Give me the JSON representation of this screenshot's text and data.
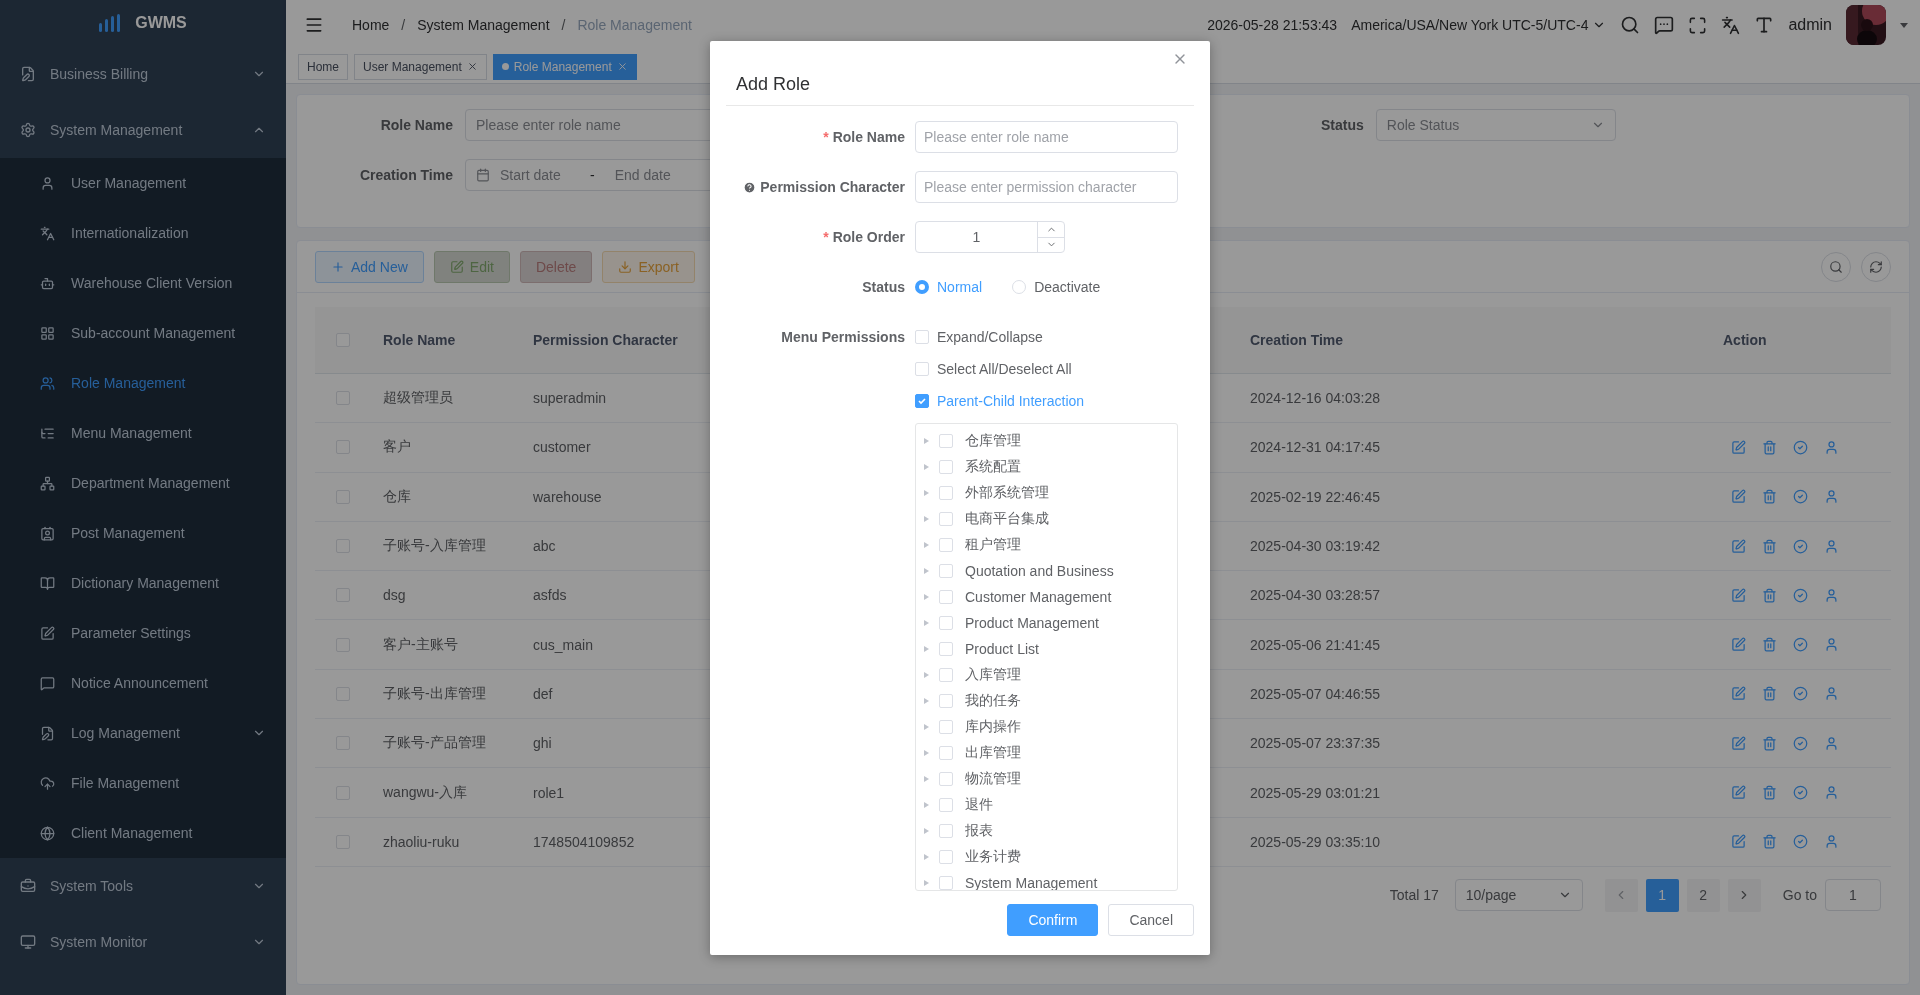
{
  "sidebar": {
    "logo": "GWMS",
    "items": [
      {
        "label": "Business Billing",
        "expanded": false
      },
      {
        "label": "System Management",
        "expanded": true,
        "children": [
          {
            "label": "User Management",
            "selected": false
          },
          {
            "label": "Internationalization",
            "selected": false
          },
          {
            "label": "Warehouse Client Version",
            "selected": false
          },
          {
            "label": "Sub-account Management",
            "selected": false
          },
          {
            "label": "Role Management",
            "selected": true
          },
          {
            "label": "Menu Management",
            "selected": false
          },
          {
            "label": "Department Management",
            "selected": false
          },
          {
            "label": "Post Management",
            "selected": false
          },
          {
            "label": "Dictionary Management",
            "selected": false
          },
          {
            "label": "Parameter Settings",
            "selected": false
          },
          {
            "label": "Notice Announcement",
            "selected": false
          },
          {
            "label": "Log Management",
            "selected": false,
            "expanded": false
          },
          {
            "label": "File Management",
            "selected": false
          },
          {
            "label": "Client Management",
            "selected": false
          }
        ]
      },
      {
        "label": "System Tools",
        "expanded": false
      },
      {
        "label": "System Monitor",
        "expanded": false
      }
    ]
  },
  "header": {
    "breadcrumbs": [
      "Home",
      "System Management",
      "Role Management"
    ],
    "separator": "/",
    "datetime": "2026-05-28 21:53:43",
    "timezone": "America/USA/New York UTC-5/UTC-4",
    "user": "admin"
  },
  "tabs": [
    {
      "label": "Home",
      "selected": false,
      "closable": false
    },
    {
      "label": "User Management",
      "selected": false,
      "closable": true
    },
    {
      "label": "Role Management",
      "selected": true,
      "closable": true
    }
  ],
  "filter": {
    "role_name": {
      "label": "Role Name",
      "placeholder": "Please enter role name"
    },
    "creation_time": {
      "label": "Creation Time",
      "start_placeholder": "Start date",
      "separator": "-",
      "end_placeholder": "End date"
    },
    "status": {
      "label": "Status",
      "placeholder": "Role Status"
    }
  },
  "toolbar": [
    {
      "label": "Add New",
      "kind": "primary",
      "disabled": false
    },
    {
      "label": "Edit",
      "kind": "success",
      "disabled": true
    },
    {
      "label": "Delete",
      "kind": "danger",
      "disabled": true
    },
    {
      "label": "Export",
      "kind": "warning",
      "disabled": false
    }
  ],
  "table": {
    "header_checked": false,
    "columns": [
      "Role Name",
      "Permission Character",
      "Creation Time",
      "Action"
    ],
    "rows": [
      {
        "role_name": "超级管理员",
        "permission_character": "superadmin",
        "creation_time": "2024-12-16 04:03:28",
        "checked": false,
        "actions_visible": false
      },
      {
        "role_name": "客户",
        "permission_character": "customer",
        "creation_time": "2024-12-31 04:17:45",
        "checked": false,
        "actions_visible": true
      },
      {
        "role_name": "仓库",
        "permission_character": "warehouse",
        "creation_time": "2025-02-19 22:46:45",
        "checked": false,
        "actions_visible": true
      },
      {
        "role_name": "子账号-入库管理",
        "permission_character": "abc",
        "creation_time": "2025-04-30 03:19:42",
        "checked": false,
        "actions_visible": true
      },
      {
        "role_name": "dsg",
        "permission_character": "asfds",
        "creation_time": "2025-04-30 03:28:57",
        "checked": false,
        "actions_visible": true
      },
      {
        "role_name": "客户-主账号",
        "permission_character": "cus_main",
        "creation_time": "2025-05-06 21:41:45",
        "checked": false,
        "actions_visible": true
      },
      {
        "role_name": "子账号-出库管理",
        "permission_character": "def",
        "creation_time": "2025-05-07 04:46:55",
        "checked": false,
        "actions_visible": true
      },
      {
        "role_name": "子账号-产品管理",
        "permission_character": "ghi",
        "creation_time": "2025-05-07 23:37:35",
        "checked": false,
        "actions_visible": true
      },
      {
        "role_name": "wangwu-入库",
        "permission_character": "role1",
        "creation_time": "2025-05-29 03:01:21",
        "checked": false,
        "actions_visible": true
      },
      {
        "role_name": "zhaoliu-ruku",
        "permission_character": "1748504109852",
        "creation_time": "2025-05-29 03:35:10",
        "checked": false,
        "actions_visible": true
      }
    ]
  },
  "pagination": {
    "total": "Total 17",
    "page_size": "10/page",
    "pages": [
      {
        "label": "1",
        "selected": true
      },
      {
        "label": "2",
        "selected": false
      }
    ],
    "goto_label": "Go to",
    "goto_value": "1"
  },
  "modal": {
    "title": "Add Role",
    "required_mark": "*",
    "fields": [
      {
        "kind": "text",
        "label": "Role Name",
        "required": true,
        "help": false,
        "placeholder": "Please enter role name"
      },
      {
        "kind": "text",
        "label": "Permission Character",
        "required": false,
        "help": true,
        "placeholder": "Please enter permission character"
      },
      {
        "kind": "number",
        "label": "Role Order",
        "required": true,
        "help": false,
        "value": "1"
      },
      {
        "kind": "radio",
        "label": "Status",
        "required": false,
        "help": false,
        "options": [
          {
            "label": "Normal",
            "selected": true
          },
          {
            "label": "Deactivate",
            "selected": false
          }
        ]
      },
      {
        "kind": "permissions",
        "label": "Menu Permissions",
        "required": false,
        "help": false,
        "options": [
          {
            "label": "Expand/Collapse",
            "checked": false
          },
          {
            "label": "Select All/Deselect All",
            "checked": false
          },
          {
            "label": "Parent-Child Interaction",
            "checked": true
          }
        ],
        "tree": [
          {
            "label": "仓库管理",
            "checked": false,
            "expanded": false
          },
          {
            "label": "系统配置",
            "checked": false,
            "expanded": false
          },
          {
            "label": "外部系统管理",
            "checked": false,
            "expanded": false
          },
          {
            "label": "电商平台集成",
            "checked": false,
            "expanded": false
          },
          {
            "label": "租户管理",
            "checked": false,
            "expanded": false
          },
          {
            "label": "Quotation and Business",
            "checked": false,
            "expanded": false
          },
          {
            "label": "Customer Management",
            "checked": false,
            "expanded": false
          },
          {
            "label": "Product Management",
            "checked": false,
            "expanded": false
          },
          {
            "label": "Product List",
            "checked": false,
            "expanded": false
          },
          {
            "label": "入库管理",
            "checked": false,
            "expanded": false
          },
          {
            "label": "我的任务",
            "checked": false,
            "expanded": false
          },
          {
            "label": "库内操作",
            "checked": false,
            "expanded": false
          },
          {
            "label": "出库管理",
            "checked": false,
            "expanded": false
          },
          {
            "label": "物流管理",
            "checked": false,
            "expanded": false
          },
          {
            "label": "退件",
            "checked": false,
            "expanded": false
          },
          {
            "label": "报表",
            "checked": false,
            "expanded": false
          },
          {
            "label": "业务计费",
            "checked": false,
            "expanded": false
          },
          {
            "label": "System Management",
            "checked": false,
            "expanded": false
          }
        ]
      }
    ],
    "buttons": [
      {
        "label": "Confirm",
        "kind": "primary"
      },
      {
        "label": "Cancel",
        "kind": "default"
      }
    ]
  }
}
